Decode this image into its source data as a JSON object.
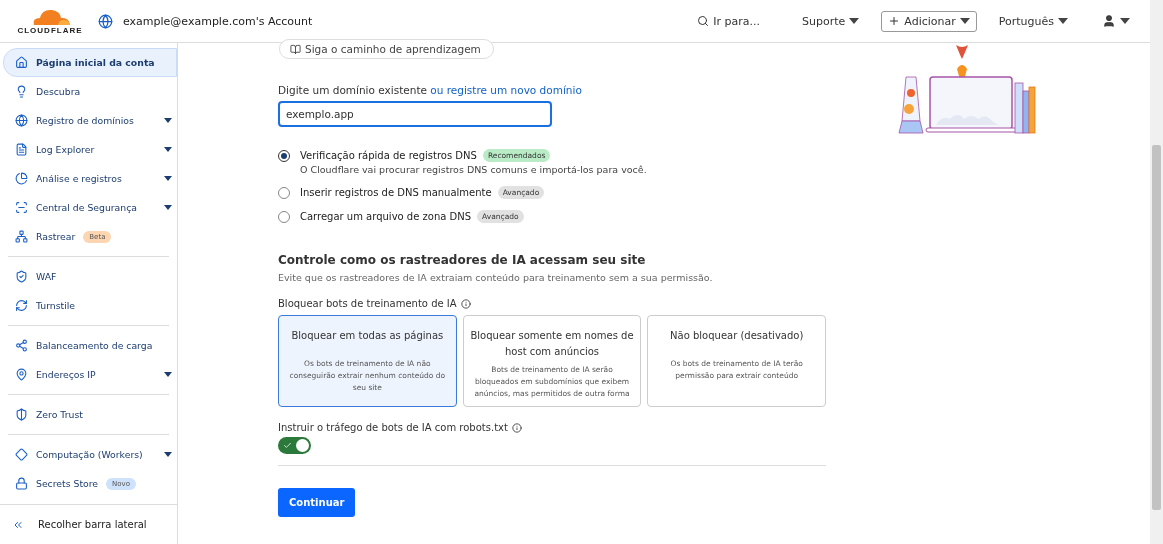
{
  "header": {
    "logo_text": "CLOUDFLARE",
    "account": "example@example.com's Account",
    "search": "Ir para...",
    "support": "Suporte",
    "add": "Adicionar",
    "language": "Português"
  },
  "sidebar": {
    "items": [
      {
        "label": "Página inicial da conta",
        "selected": true,
        "expandable": false,
        "divider_after": false
      },
      {
        "label": "Descubra",
        "selected": false,
        "expandable": false,
        "divider_after": false
      },
      {
        "label": "Registro de domínios",
        "selected": false,
        "expandable": true,
        "divider_after": false
      },
      {
        "label": "Log Explorer",
        "selected": false,
        "expandable": true,
        "divider_after": false
      },
      {
        "label": "Análise e registros",
        "selected": false,
        "expandable": true,
        "divider_after": false
      },
      {
        "label": "Central de Segurança",
        "selected": false,
        "expandable": true,
        "divider_after": false
      },
      {
        "label": "Rastrear",
        "selected": false,
        "expandable": false,
        "divider_after": true,
        "badge": {
          "label": "Beta",
          "color": "#fdd5b1"
        }
      },
      {
        "label": "WAF",
        "selected": false,
        "expandable": false,
        "divider_after": false
      },
      {
        "label": "Turnstile",
        "selected": false,
        "expandable": false,
        "divider_after": true
      },
      {
        "label": "Balanceamento de carga",
        "selected": false,
        "expandable": false,
        "divider_after": false
      },
      {
        "label": "Endereços IP",
        "selected": false,
        "expandable": true,
        "divider_after": true
      },
      {
        "label": "Zero Trust",
        "selected": false,
        "expandable": false,
        "divider_after": true
      },
      {
        "label": "Computação (Workers)",
        "selected": false,
        "expandable": true,
        "divider_after": false
      },
      {
        "label": "Secrets Store",
        "selected": false,
        "expandable": false,
        "divider_after": false,
        "badge": {
          "label": "Novo",
          "color": "#cfe2fb"
        }
      }
    ],
    "collapse": "Recolher barra lateral"
  },
  "main": {
    "learning_path": "Siga o caminho de aprendizagem",
    "domain_label": "Digite um domínio existente",
    "domain_link": "ou registre um novo domínio",
    "domain_value": "exemplo.app",
    "scan_options": [
      {
        "label": "Verificação rápida de registros DNS",
        "selected": true,
        "tag": {
          "label": "Recomendados",
          "color": "#b9ecc6"
        },
        "description": "O Cloudflare vai procurar registros DNS comuns e importá-los para você."
      },
      {
        "label": "Inserir registros de DNS manualmente",
        "selected": false,
        "tag": {
          "label": "Avançado",
          "color": "#e1e1e1"
        }
      },
      {
        "label": "Carregar um arquivo de zona DNS",
        "selected": false,
        "tag": {
          "label": "Avançado",
          "color": "#e1e1e1"
        }
      }
    ],
    "ai_heading": "Controle como os rastreadores de IA acessam seu site",
    "ai_subtitle": "Evite que os rastreadores de IA extraiam conteúdo para treinamento sem a sua permissão.",
    "block_label": "Bloquear bots de treinamento de IA",
    "block_options": [
      {
        "title": "Bloquear em todas as páginas",
        "description": "Os bots de treinamento de IA não conseguirão extrair nenhum conteúdo do seu site",
        "selected": true
      },
      {
        "title": "Bloquear somente em nomes de host com anúncios",
        "description": "Bots de treinamento de IA serão bloqueados em subdomínios que exibem anúncios, mas permitidos de outra forma",
        "selected": false
      },
      {
        "title": "Não bloquear (desativado)",
        "description": "Os bots de treinamento de IA terão permissão para extrair conteúdo",
        "selected": false
      }
    ],
    "robots_label": "Instruir o tráfego de bots de IA com robots.txt",
    "robots_on": true,
    "continue": "Continuar"
  }
}
